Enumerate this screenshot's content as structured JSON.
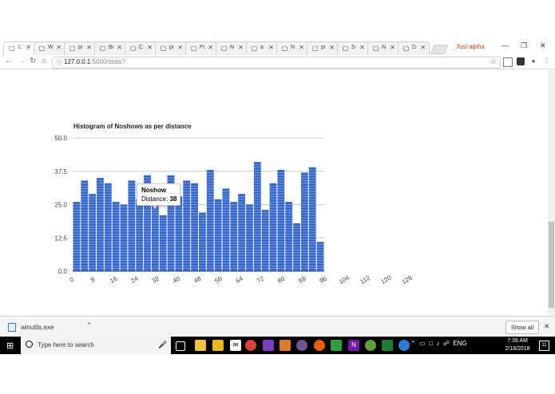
{
  "browser": {
    "tabs": [
      {
        "label": "1:",
        "icon": "page-icon",
        "active": true
      },
      {
        "label": "W",
        "icon": "whatsapp-icon"
      },
      {
        "label": "pi",
        "icon": "pluralsight-icon"
      },
      {
        "label": "Bi",
        "icon": "bi-icon"
      },
      {
        "label": "C",
        "icon": "page-icon"
      },
      {
        "label": "pi",
        "icon": "pluralsight-icon"
      },
      {
        "label": "Pi",
        "icon": "python-icon"
      },
      {
        "label": "N",
        "icon": "pluralsight-icon"
      },
      {
        "label": "a",
        "icon": "google-icon"
      },
      {
        "label": "N",
        "icon": "pluralsight-icon"
      },
      {
        "label": "pi",
        "icon": "pluralsight-icon"
      },
      {
        "label": "S",
        "icon": "pluralsight-icon"
      },
      {
        "label": "N",
        "icon": "folder-icon"
      },
      {
        "label": "D",
        "icon": "circle-icon"
      }
    ],
    "profile_name": "fosl-alpha",
    "url_host": "127.0.0.1",
    "url_path": ":5000/stats?"
  },
  "chart_data": {
    "type": "bar",
    "title": "Histogram of Noshows as per distance",
    "xlabel": "",
    "ylabel": "",
    "ylim": [
      0,
      50
    ],
    "yticks": [
      "0.0",
      "12.5",
      "25.0",
      "37.5",
      "50.0"
    ],
    "xticks": [
      "0",
      "8",
      "16",
      "24",
      "32",
      "40",
      "48",
      "56",
      "64",
      "72",
      "80",
      "88",
      "96",
      "104",
      "112",
      "120",
      "128"
    ],
    "bin_width": 3,
    "bins_start": 0,
    "values": [
      26,
      34,
      29,
      35,
      33,
      26,
      25,
      34,
      27,
      36,
      31,
      21,
      36,
      28,
      34,
      33,
      22,
      38,
      27,
      31,
      26,
      29,
      25,
      41,
      23,
      33,
      38,
      26,
      18,
      37,
      39,
      11
    ],
    "color": "#3366cc",
    "gridlines": true,
    "tooltip": {
      "title": "Noshow",
      "label": "Distance",
      "value": "38"
    }
  },
  "downloads": {
    "file_name": "winutils.exe",
    "show_all_label": "Show all"
  },
  "taskbar": {
    "search_placeholder": "Type here to search",
    "language": "ENG",
    "time": "7:39 AM",
    "date": "2/18/2018",
    "notification_count": "11"
  }
}
